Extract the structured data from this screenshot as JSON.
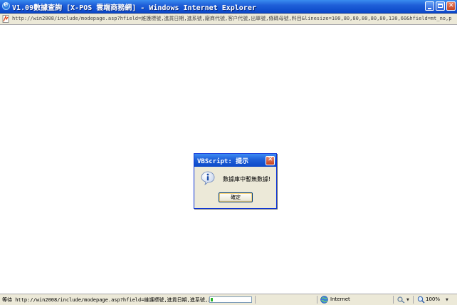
{
  "window": {
    "title": "V1.09數據查詢 [X-POS 雲端商務網] - Windows Internet Explorer"
  },
  "address": {
    "url": "http://win2008/include/modepage.asp?hfield=維護標號,進貨日期,進系號,廠商代號,客户代號,出單號,條碼母號,料目&linesize=100,80,80,80,80,80,130,60&hfield=mt_no,prd_no"
  },
  "dialog": {
    "title": "VBScript: 提示",
    "message": "數據庫中暫無數據!",
    "ok_label": "確定",
    "icon": "info-icon"
  },
  "statusbar": {
    "text": "等待 http://win2008/include/modepage.asp?hfield=維護標號,進貨日期,進系號,廠",
    "progress": 0.05,
    "zone": "Internet",
    "zoom": "100%"
  },
  "colors": {
    "titlebar": "#0a47c8",
    "chrome": "#ece9d8",
    "close_button": "#c5431f",
    "progress_fill": "#2bb52b"
  }
}
